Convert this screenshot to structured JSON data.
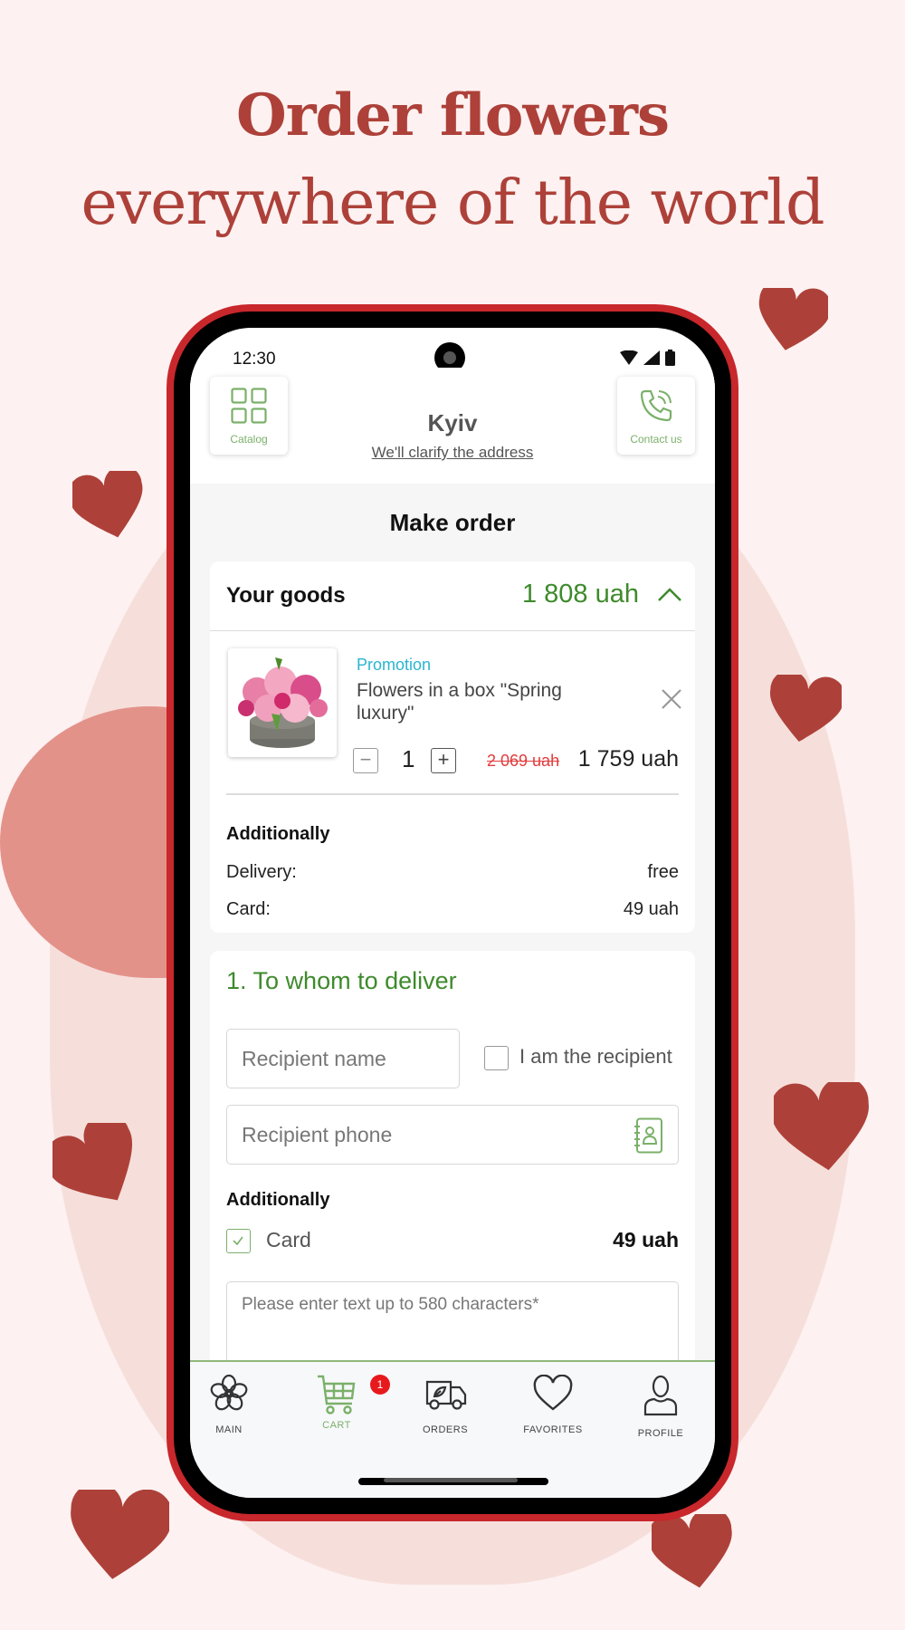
{
  "promo": {
    "headline_bold": "Order flowers",
    "headline_regular": "everywhere of the world"
  },
  "colors": {
    "brand_red": "#ad4139",
    "accent_green": "#3e8a2c",
    "light_green": "#7bb06a",
    "promo_blue": "#29b5cf",
    "strike_red": "#e23c3c",
    "badge_red": "#e8191d"
  },
  "statusbar": {
    "time": "12:30",
    "icons": [
      "wifi-icon",
      "signal-icon",
      "battery-icon"
    ]
  },
  "header": {
    "catalog_label": "Catalog",
    "city": "Kyiv",
    "address_link": "We'll clarify the address",
    "contact_label": "Contact us"
  },
  "page": {
    "title": "Make order"
  },
  "goods": {
    "title": "Your goods",
    "total": "1 808 uah",
    "items": [
      {
        "badge": "Promotion",
        "name": "Flowers in a box \"Spring luxury\"",
        "quantity": "1",
        "old_price": "2 069 uah",
        "price": "1 759 uah"
      }
    ],
    "additionally_title": "Additionally",
    "rows": [
      {
        "label": "Delivery:",
        "value": "free"
      },
      {
        "label": "Card:",
        "value": "49 uah"
      }
    ]
  },
  "delivery": {
    "section_title": "1. To whom to deliver",
    "recipient_name_placeholder": "Recipient name",
    "i_am_recipient_label": "I am the recipient",
    "i_am_recipient_checked": false,
    "recipient_phone_placeholder": "Recipient phone",
    "additionally_title": "Additionally",
    "card_option_label": "Card",
    "card_option_price": "49 uah",
    "card_option_checked": true,
    "card_text_placeholder": "Please enter text up to 580 characters*"
  },
  "bottom_nav": {
    "items": [
      {
        "label": "MAIN",
        "icon": "flower-icon",
        "active": false
      },
      {
        "label": "CART",
        "icon": "cart-icon",
        "active": true,
        "badge": "1"
      },
      {
        "label": "ORDERS",
        "icon": "delivery-truck-icon",
        "active": false
      },
      {
        "label": "FAVORITES",
        "icon": "heart-icon",
        "active": false
      },
      {
        "label": "PROFILE",
        "icon": "user-icon",
        "active": false
      }
    ]
  }
}
